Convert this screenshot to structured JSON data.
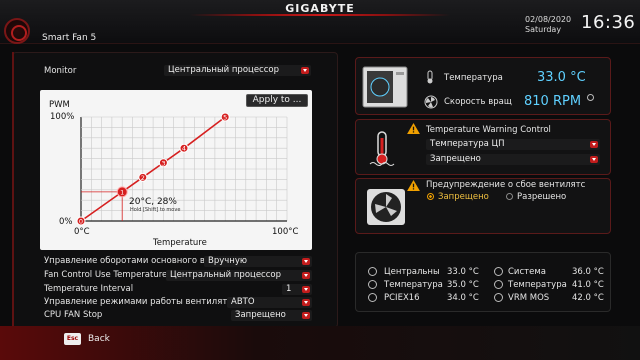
{
  "header": {
    "brand": "GIGABYTE",
    "page_title": "Smart Fan 5",
    "date": "02/08/2020",
    "weekday": "Saturday",
    "time": "16:36"
  },
  "monitor": {
    "label": "Monitor",
    "value": "Центральный процессор"
  },
  "graph": {
    "apply_label": "Apply to ...",
    "y_axis_title": "PWM",
    "y_max_label": "100%",
    "y_min_label": "0%",
    "x_min_label": "0°C",
    "x_max_label": "100°C",
    "x_axis_title": "Temperature",
    "point_readout": "20°C, 28%",
    "hint": "Hold [Shift] to move",
    "points": [
      {
        "label": "0",
        "temp": 0,
        "pwm": 0
      },
      {
        "label": "1",
        "temp": 20,
        "pwm": 28
      },
      {
        "label": "2",
        "temp": 30,
        "pwm": 42
      },
      {
        "label": "3",
        "temp": 40,
        "pwm": 56
      },
      {
        "label": "4",
        "temp": 50,
        "pwm": 70
      },
      {
        "label": "5",
        "temp": 70,
        "pwm": 100
      }
    ]
  },
  "settings": [
    {
      "label": "Управление оборотами основного вентилятора",
      "value": "Вручную"
    },
    {
      "label": "Fan Control Use Temperature Input",
      "value": "Центральный процессор"
    },
    {
      "label": "Temperature Interval",
      "value": "1"
    },
    {
      "label": "Управление режимами работы вентилятора",
      "value": "АВТО"
    },
    {
      "label": "CPU FAN Stop",
      "value": "Запрещено"
    }
  ],
  "status": {
    "temp_label": "Температура",
    "temp_value": "33.0 °C",
    "speed_label": "Скорость вращ",
    "speed_value": "810 RPM"
  },
  "temp_warning": {
    "title": "Temperature Warning Control",
    "source": "Температура ЦП",
    "value": "Запрещено"
  },
  "fan_fail": {
    "title": "Предупреждение о сбое вентилятс",
    "option_disabled": "Запрещено",
    "option_enabled": "Разрешено"
  },
  "hardware_monitor": [
    {
      "label": "Центральны",
      "value": "33.0 °C"
    },
    {
      "label": "Система",
      "value": "36.0 °C"
    },
    {
      "label": "Температура",
      "value": "35.0 °C"
    },
    {
      "label": "Температура",
      "value": "41.0 °C"
    },
    {
      "label": "PCIEX16",
      "value": "34.0 °C"
    },
    {
      "label": "VRM MOS",
      "value": "42.0 °C"
    }
  ],
  "footer": {
    "esc_label": "Esc",
    "back_label": "Back"
  },
  "colors": {
    "accent": "#c21c1c",
    "value_blue": "#5fd0ff",
    "warning": "#f0a000"
  }
}
